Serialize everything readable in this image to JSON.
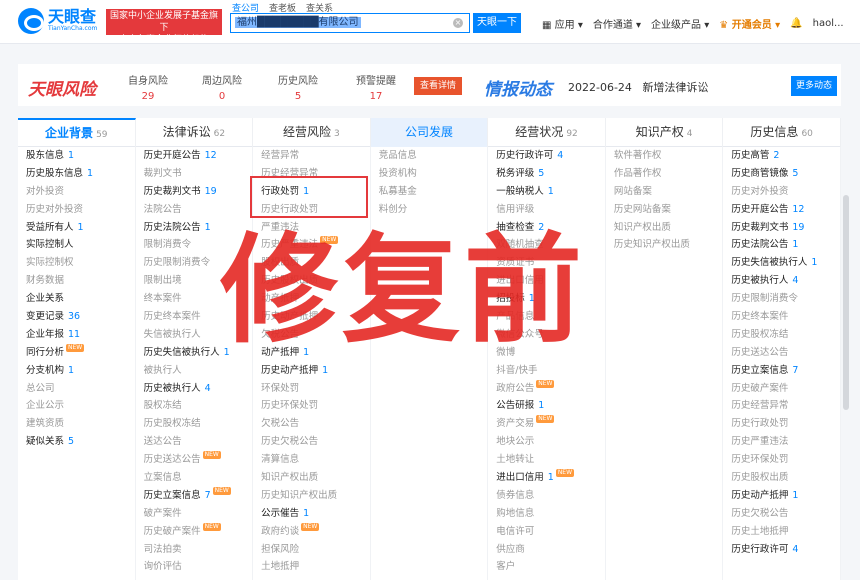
{
  "header": {
    "logo": "天眼查",
    "logo_sub": "TianYanCha.com",
    "promo_line1": "国家中小企业发展子基金旗下",
    "promo_line2": "官方备案企业征信机构",
    "search_tabs": [
      "查公司",
      "查老板",
      "查关系"
    ],
    "search_value": "福州████████有限公司",
    "search_button": "天眼一下",
    "nav": [
      "应用",
      "合作通道",
      "企业级产品",
      "开通会员",
      "haol..."
    ]
  },
  "risk_bar": {
    "logo": "天眼风险",
    "stats": [
      {
        "label": "自身风险",
        "value": "29"
      },
      {
        "label": "周边风险",
        "value": "0"
      },
      {
        "label": "历史风险",
        "value": "5"
      },
      {
        "label": "预警提醒",
        "value": "17"
      }
    ],
    "detail_button": "查看详情",
    "intel_title": "情报动态",
    "date": "2022-06-24",
    "event": "新增法律诉讼",
    "more_button": "更多动态"
  },
  "tabs": [
    {
      "label": "企业背景",
      "count": "59"
    },
    {
      "label": "法律诉讼",
      "count": "62"
    },
    {
      "label": "经营风险",
      "count": "3"
    },
    {
      "label": "公司发展",
      "count": ""
    },
    {
      "label": "经营状况",
      "count": "92"
    },
    {
      "label": "知识产权",
      "count": "4"
    },
    {
      "label": "历史信息",
      "count": "60"
    }
  ],
  "columns": [
    [
      {
        "t": "股东信息",
        "n": "1"
      },
      {
        "t": "历史股东信息",
        "n": "1"
      },
      {
        "t": "对外投资",
        "g": 1
      },
      {
        "t": "历史对外投资",
        "g": 1
      },
      {
        "t": "受益所有人",
        "n": "1"
      },
      {
        "t": "实际控制人"
      },
      {
        "t": "实际控制权",
        "g": 1
      },
      {
        "t": "财务数据",
        "g": 1
      },
      {
        "t": "企业关系"
      },
      {
        "t": "变更记录",
        "n": "36"
      },
      {
        "t": "企业年报",
        "n": "11"
      },
      {
        "t": "同行分析",
        "nw": 1
      },
      {
        "t": "分支机构",
        "n": "1"
      },
      {
        "t": "总公司",
        "g": 1
      },
      {
        "t": "企业公示",
        "g": 1
      },
      {
        "t": "建筑资质",
        "g": 1
      },
      {
        "t": "疑似关系",
        "n": "5"
      }
    ],
    [
      {
        "t": "历史开庭公告",
        "n": "12"
      },
      {
        "t": "裁判文书",
        "g": 1
      },
      {
        "t": "历史裁判文书",
        "n": "19"
      },
      {
        "t": "法院公告",
        "g": 1
      },
      {
        "t": "历史法院公告",
        "n": "1"
      },
      {
        "t": "限制消费令",
        "g": 1
      },
      {
        "t": "历史限制消费令",
        "g": 1
      },
      {
        "t": "限制出境",
        "g": 1
      },
      {
        "t": "终本案件",
        "g": 1
      },
      {
        "t": "历史终本案件",
        "g": 1
      },
      {
        "t": "失信被执行人",
        "g": 1
      },
      {
        "t": "历史失信被执行人",
        "n": "1"
      },
      {
        "t": "被执行人",
        "g": 1
      },
      {
        "t": "历史被执行人",
        "n": "4"
      },
      {
        "t": "股权冻结",
        "g": 1
      },
      {
        "t": "历史股权冻结",
        "g": 1
      },
      {
        "t": "送达公告",
        "g": 1
      },
      {
        "t": "历史送达公告",
        "g": 1,
        "nw": 1
      },
      {
        "t": "立案信息",
        "g": 1
      },
      {
        "t": "历史立案信息",
        "n": "7",
        "nw": 1
      },
      {
        "t": "破产案件",
        "g": 1
      },
      {
        "t": "历史破产案件",
        "g": 1,
        "nw": 1
      },
      {
        "t": "司法拍卖",
        "g": 1
      },
      {
        "t": "询价评估",
        "g": 1
      }
    ],
    [
      {
        "t": "经营异常",
        "g": 1
      },
      {
        "t": "历史经营异常",
        "g": 1
      },
      {
        "t": "行政处罚",
        "n": "1"
      },
      {
        "t": "历史行政处罚",
        "g": 1
      },
      {
        "t": "严重违法",
        "g": 1
      },
      {
        "t": "历史严重违法",
        "g": 1,
        "nw": 1
      },
      {
        "t": "股权出质",
        "g": 1
      },
      {
        "t": "历史股权出质",
        "g": 1
      },
      {
        "t": "动产抵押",
        "g": 1
      },
      {
        "t": "历史动产抵押",
        "g": 1
      },
      {
        "t": "欠税公告",
        "g": 1
      },
      {
        "t": "动产抵押",
        "n": "1"
      },
      {
        "t": "历史动产抵押",
        "n": "1"
      },
      {
        "t": "环保处罚",
        "g": 1
      },
      {
        "t": "历史环保处罚",
        "g": 1
      },
      {
        "t": "欠税公告",
        "g": 1
      },
      {
        "t": "历史欠税公告",
        "g": 1
      },
      {
        "t": "清算信息",
        "g": 1
      },
      {
        "t": "知识产权出质",
        "g": 1
      },
      {
        "t": "历史知识产权出质",
        "g": 1
      },
      {
        "t": "公示催告",
        "n": "1"
      },
      {
        "t": "政府约谈",
        "g": 1,
        "nw": 1
      },
      {
        "t": "担保风险",
        "g": 1
      },
      {
        "t": "土地抵押",
        "g": 1
      }
    ],
    [
      {
        "t": "竞品信息",
        "g": 1
      },
      {
        "t": "投资机构",
        "g": 1
      },
      {
        "t": "私募基金",
        "g": 1
      },
      {
        "t": "料创分",
        "g": 1
      }
    ],
    [
      {
        "t": "历史行政许可",
        "n": "4"
      },
      {
        "t": "税务评级",
        "n": "5"
      },
      {
        "t": "一般纳税人",
        "n": "1"
      },
      {
        "t": "信用评级",
        "g": 1
      },
      {
        "t": "抽查检查",
        "n": "2"
      },
      {
        "t": "双随机抽查",
        "g": 1
      },
      {
        "t": "资质证书",
        "g": 1
      },
      {
        "t": "进出口信用",
        "g": 1
      },
      {
        "t": "招投标",
        "n": "1"
      },
      {
        "t": "产品信息",
        "g": 1
      },
      {
        "t": "微信公众号",
        "g": 1
      },
      {
        "t": "微博",
        "g": 1
      },
      {
        "t": "抖音/快手",
        "g": 1
      },
      {
        "t": "政府公告",
        "g": 1,
        "nw": 1
      },
      {
        "t": "公告研报",
        "n": "1"
      },
      {
        "t": "资产交易",
        "g": 1,
        "nw": 1
      },
      {
        "t": "地块公示",
        "g": 1
      },
      {
        "t": "土地转让",
        "g": 1
      },
      {
        "t": "进出口信用",
        "n": "1",
        "nw": 1
      },
      {
        "t": "债券信息",
        "g": 1
      },
      {
        "t": "购地信息",
        "g": 1
      },
      {
        "t": "电信许可",
        "g": 1
      },
      {
        "t": "供应商",
        "g": 1
      },
      {
        "t": "客户",
        "g": 1
      }
    ],
    [
      {
        "t": "软件著作权",
        "g": 1
      },
      {
        "t": "作品著作权",
        "g": 1
      },
      {
        "t": "网站备案",
        "g": 1
      },
      {
        "t": "历史网站备案",
        "g": 1
      },
      {
        "t": "知识产权出质",
        "g": 1
      },
      {
        "t": "历史知识产权出质",
        "g": 1
      }
    ],
    [
      {
        "t": "历史高管",
        "n": "2"
      },
      {
        "t": "历史商管镜像",
        "n": "5"
      },
      {
        "t": "历史对外投资",
        "g": 1
      },
      {
        "t": "历史开庭公告",
        "n": "12"
      },
      {
        "t": "历史裁判文书",
        "n": "19"
      },
      {
        "t": "历史法院公告",
        "n": "1"
      },
      {
        "t": "历史失信被执行人",
        "n": "1"
      },
      {
        "t": "历史被执行人",
        "n": "4"
      },
      {
        "t": "历史限制消费令",
        "g": 1
      },
      {
        "t": "历史终本案件",
        "g": 1
      },
      {
        "t": "历史股权冻结",
        "g": 1
      },
      {
        "t": "历史送达公告",
        "g": 1
      },
      {
        "t": "历史立案信息",
        "n": "7"
      },
      {
        "t": "历史破产案件",
        "g": 1
      },
      {
        "t": "历史经营异常",
        "g": 1
      },
      {
        "t": "历史行政处罚",
        "g": 1
      },
      {
        "t": "历史严重违法",
        "g": 1
      },
      {
        "t": "历史环保处罚",
        "g": 1
      },
      {
        "t": "历史股权出质",
        "g": 1
      },
      {
        "t": "历史动产抵押",
        "n": "1"
      },
      {
        "t": "历史欠税公告",
        "g": 1
      },
      {
        "t": "历史土地抵押",
        "g": 1
      },
      {
        "t": "历史行政许可",
        "n": "4"
      }
    ]
  ],
  "stamp_text": "修复前",
  "colors": {
    "brand": "#0084ff",
    "risk": "#e4393c"
  }
}
